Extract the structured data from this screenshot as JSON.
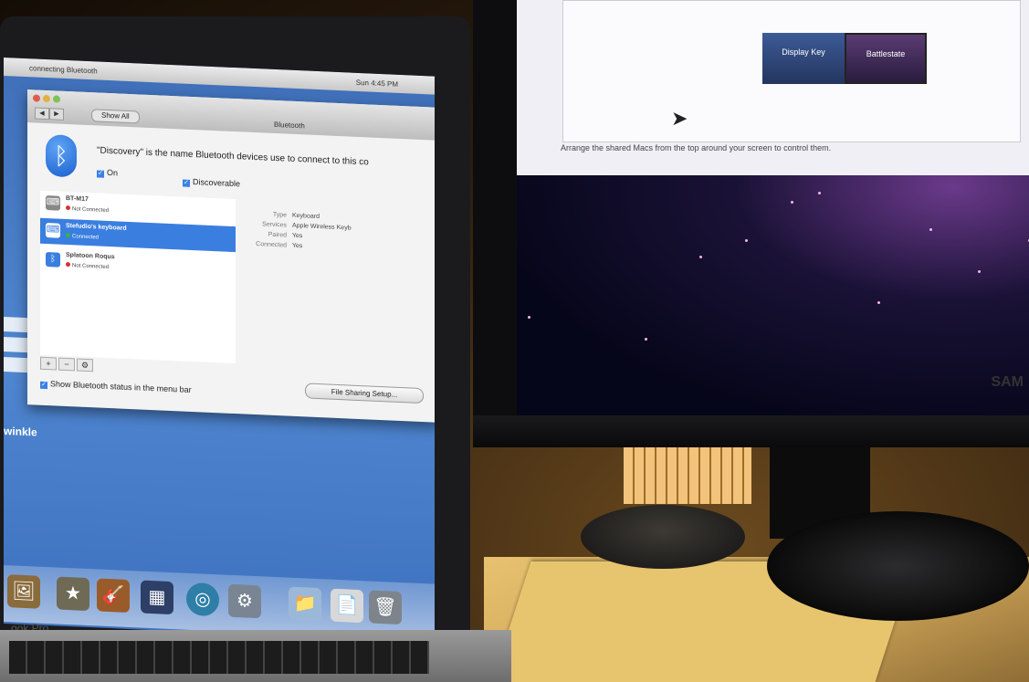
{
  "laptop": {
    "menubar": {
      "app_name": "connecting Bluetooth",
      "clock": "Sun 4:45 PM"
    },
    "window": {
      "title": "Bluetooth",
      "show_all": "Show All",
      "nav_back": "◀",
      "nav_forward": "▶",
      "discovery_text": "\"Discovery\" is the name Bluetooth devices use to connect to this co",
      "on_label": "On",
      "discoverable_label": "Discoverable",
      "devices": [
        {
          "name": "BT-M17",
          "status": "Not Connected",
          "icon": "keyboard-icon"
        },
        {
          "name": "Stefudio's keyboard",
          "status": "Connected",
          "icon": "keyboard-icon"
        },
        {
          "name": "Splatoon Roqus",
          "status": "Not Connected",
          "icon": "bluetooth-icon"
        }
      ],
      "details": [
        {
          "label": "Type",
          "value": "Keyboard"
        },
        {
          "label": "Services",
          "value": "Apple Wireless Keyb"
        },
        {
          "label": "Paired",
          "value": "Yes"
        },
        {
          "label": "Connected",
          "value": "Yes"
        }
      ],
      "list_controls": [
        "+",
        "−",
        "⚙"
      ],
      "show_status_label": "Show Bluetooth status in the menu bar",
      "file_sharing_button": "File Sharing Setup..."
    },
    "desktop_label": "winkle",
    "model_label": "ook Pro"
  },
  "monitor": {
    "thumb_a": "Display Key",
    "thumb_b": "Battlestate",
    "arrange_text": "Arrange the shared Macs from the top around your screen to control them.",
    "brand": "SAM"
  },
  "colors": {
    "selection": "#3a7ee0",
    "desktop_blue": "#4f86d0",
    "connected_dot": "#37b34a",
    "not_connected_dot": "#d9302c"
  }
}
